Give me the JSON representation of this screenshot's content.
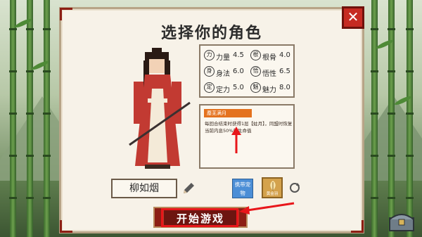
{
  "title": "选择你的角色",
  "close_label": "✕",
  "stats": [
    {
      "icon": "力",
      "name": "力量",
      "value": "4.5"
    },
    {
      "icon": "根",
      "name": "根骨",
      "value": "4.0"
    },
    {
      "icon": "身",
      "name": "身法",
      "value": "6.0"
    },
    {
      "icon": "悟",
      "name": "悟性",
      "value": "6.5"
    },
    {
      "icon": "定",
      "name": "定力",
      "value": "5.0"
    },
    {
      "icon": "魅",
      "name": "魅力",
      "value": "8.0"
    }
  ],
  "talent": {
    "tag": "蘼芜满月",
    "description": "每回合结束时获得1层【蛀月】，同盟时恢复当前内息50%的生命值"
  },
  "character_name": "柳如烟",
  "pet_button": "携带宠物",
  "gold_item_label": "黄金羽",
  "start_button": "开始游戏",
  "colors": {
    "accent_red": "#8c1e14",
    "close_red": "#c62b22",
    "talent_orange": "#e4721e",
    "pet_blue": "#4b8ed6",
    "annotation_red": "#e8161a"
  }
}
